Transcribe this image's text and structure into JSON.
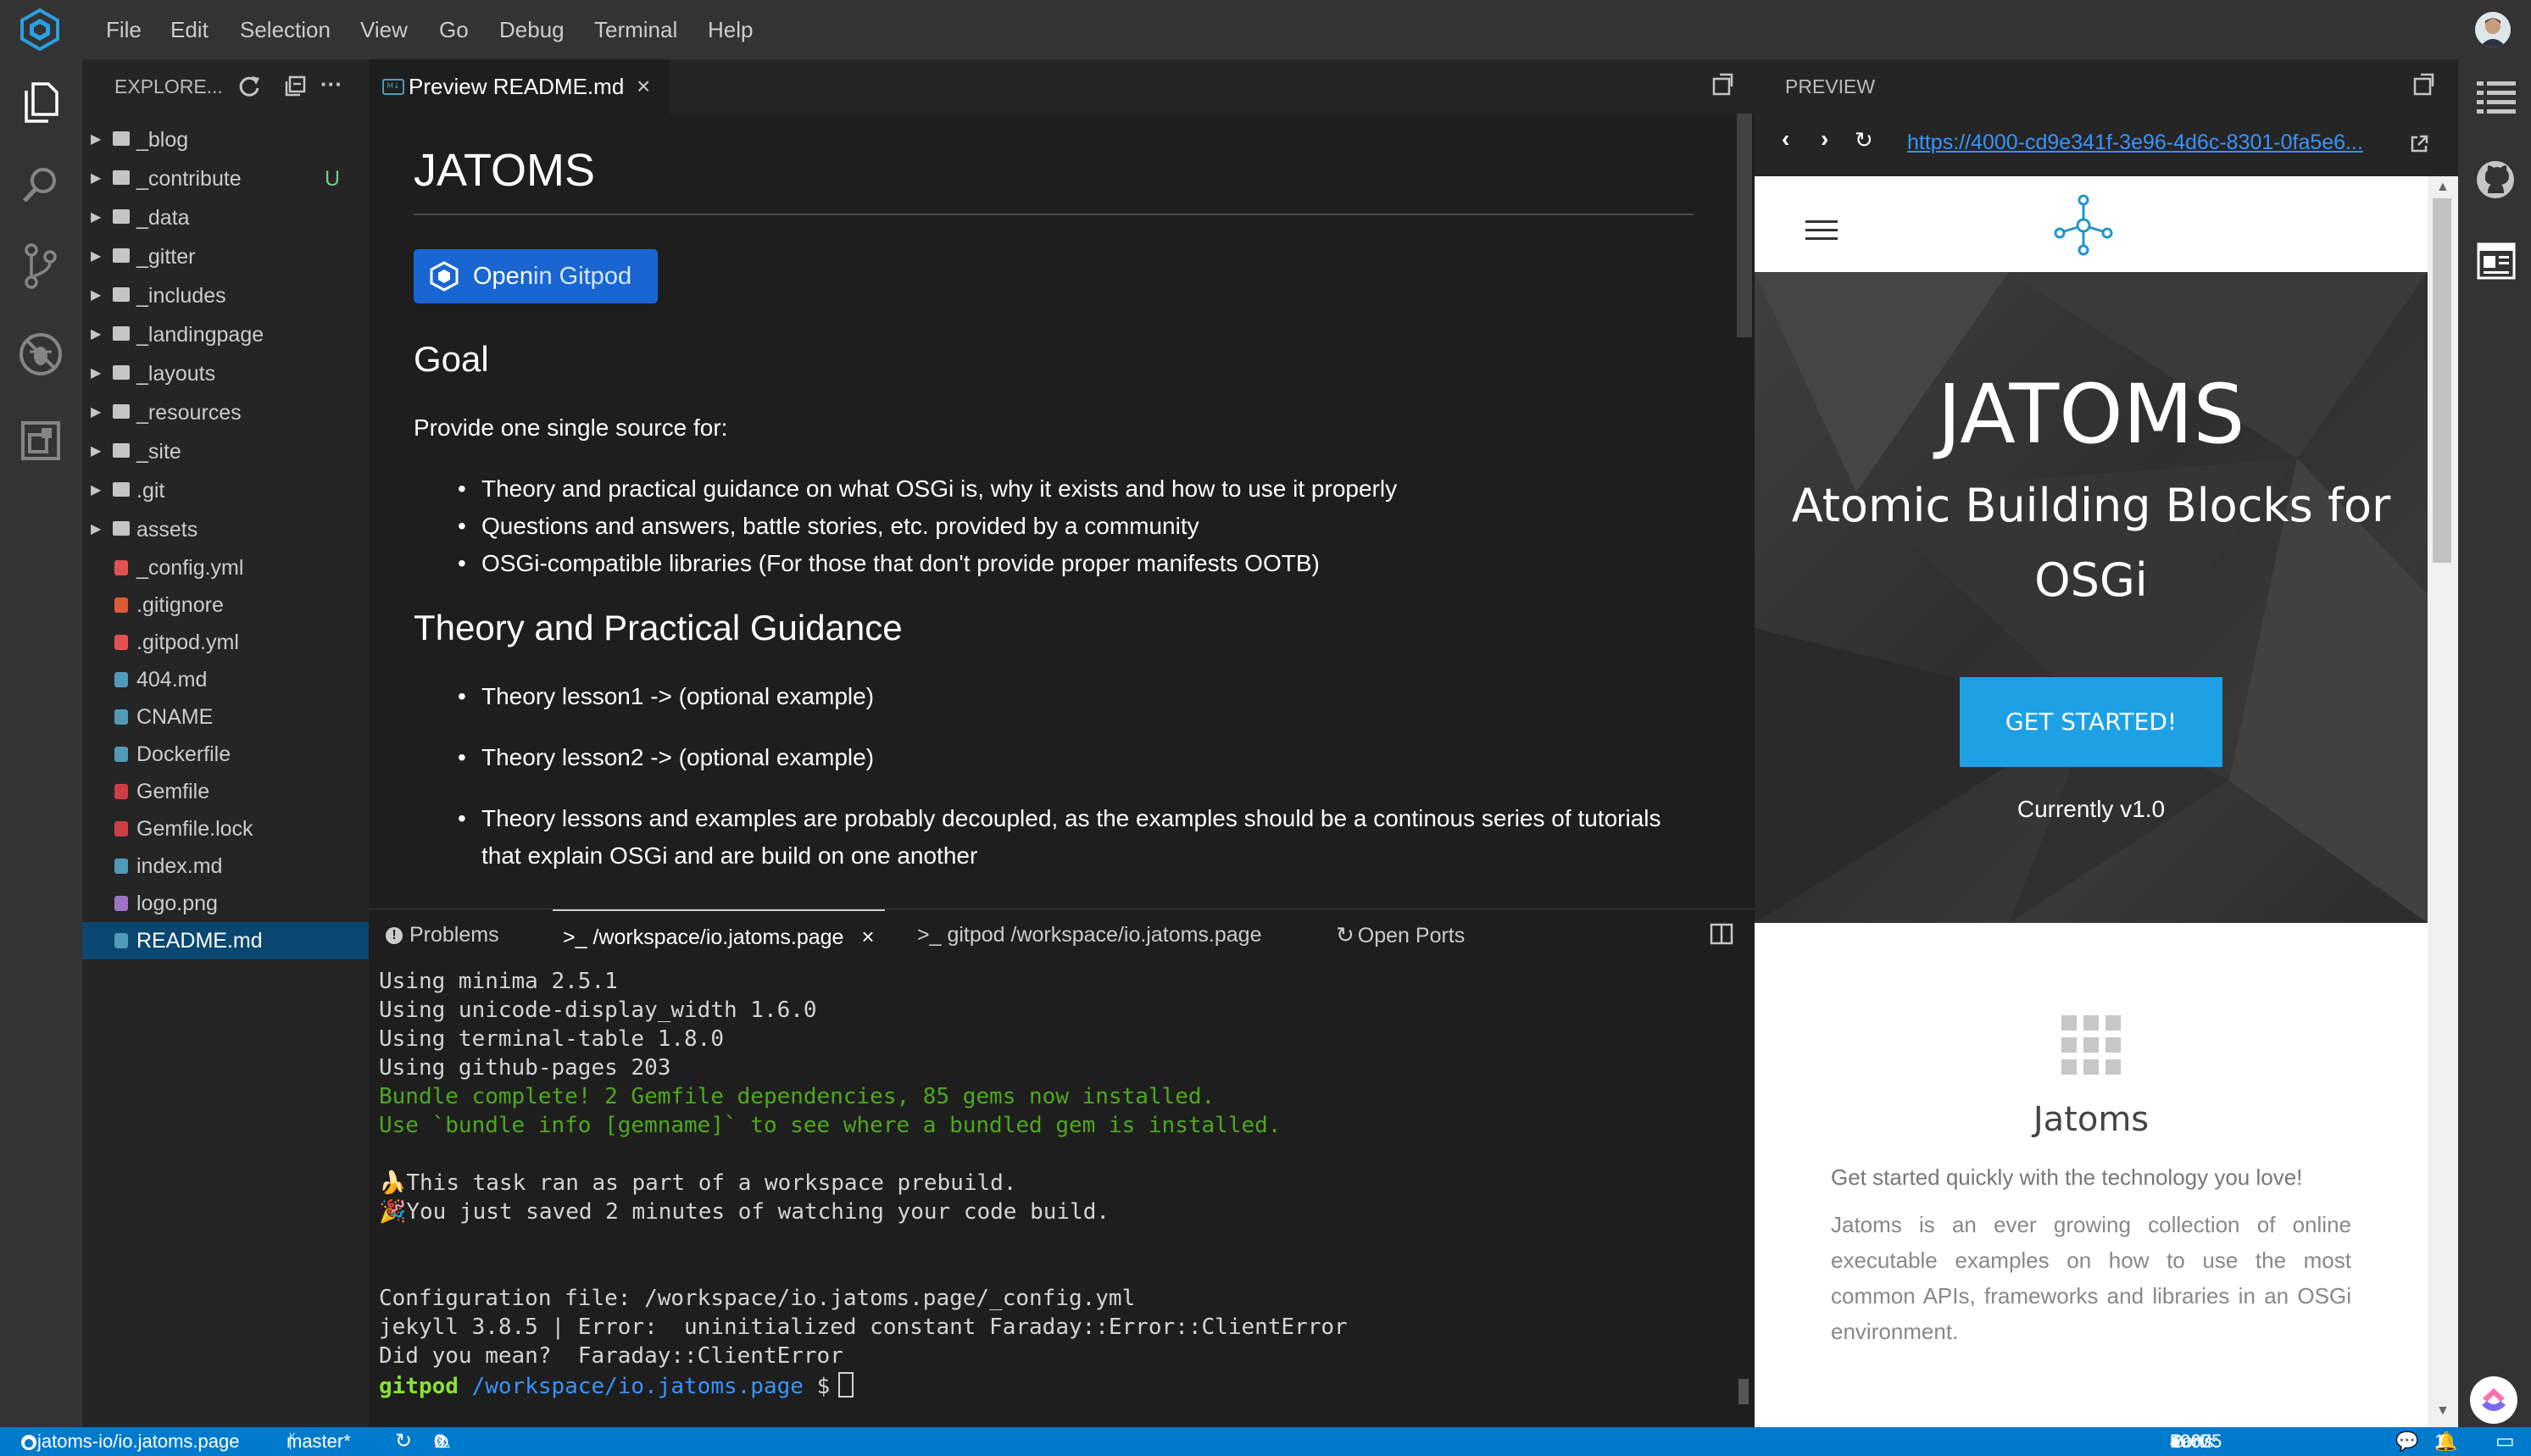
{
  "menubar": {
    "items": [
      "File",
      "Edit",
      "Selection",
      "View",
      "Go",
      "Debug",
      "Terminal",
      "Help"
    ],
    "brand_color": "#2aa0e0"
  },
  "activity_bar": {
    "icons": [
      "files-icon",
      "search-icon",
      "source-control-icon",
      "debug-icon",
      "extensions-icon"
    ]
  },
  "explorer": {
    "title": "EXPLORE...",
    "items": [
      {
        "label": "_blog",
        "type": "folder"
      },
      {
        "label": "_contribute",
        "type": "folder",
        "badge": "U"
      },
      {
        "label": "_data",
        "type": "folder"
      },
      {
        "label": "_gitter",
        "type": "folder"
      },
      {
        "label": "_includes",
        "type": "folder"
      },
      {
        "label": "_landingpage",
        "type": "folder"
      },
      {
        "label": "_layouts",
        "type": "folder"
      },
      {
        "label": "_resources",
        "type": "folder"
      },
      {
        "label": "_site",
        "type": "folder"
      },
      {
        "label": ".git",
        "type": "folder"
      },
      {
        "label": "assets",
        "type": "folder"
      },
      {
        "label": "_config.yml",
        "type": "file",
        "color": "#e05252"
      },
      {
        "label": ".gitignore",
        "type": "file",
        "color": "#e05a36"
      },
      {
        "label": ".gitpod.yml",
        "type": "file",
        "color": "#e05252"
      },
      {
        "label": "404.md",
        "type": "file",
        "color": "#519aba"
      },
      {
        "label": "CNAME",
        "type": "file",
        "color": "#519aba"
      },
      {
        "label": "Dockerfile",
        "type": "file",
        "color": "#519aba"
      },
      {
        "label": "Gemfile",
        "type": "file",
        "color": "#cc3e44"
      },
      {
        "label": "Gemfile.lock",
        "type": "file",
        "color": "#cc3e44"
      },
      {
        "label": "index.md",
        "type": "file",
        "color": "#519aba"
      },
      {
        "label": "logo.png",
        "type": "file",
        "color": "#a074c4"
      },
      {
        "label": "README.md",
        "type": "file",
        "color": "#519aba",
        "selected": true
      }
    ],
    "badge_color": "#73c991"
  },
  "editor": {
    "tab_label": "Preview README.md",
    "h1": "JATOMS",
    "gitpod_button": {
      "open": "Open",
      "in": "in Gitpod"
    },
    "goal_heading": "Goal",
    "goal_text": "Provide one single source for:",
    "goal_items": [
      "Theory and practical guidance on what OSGi is, why it exists and how to use it properly",
      "Questions and answers, battle stories, etc. provided by a community",
      "OSGi-compatible libraries (For those that don't provide proper manifests OOTB)"
    ],
    "theory_heading": "Theory and Practical Guidance",
    "theory_items": [
      "Theory lesson1 -> (optional example)",
      "Theory lesson2 -> (optional example)",
      "Theory lessons and examples are probably decoupled, as the examples should be a continous series of tutorials",
      "that explain OSGi and are build on one another"
    ]
  },
  "panel": {
    "tabs": [
      "Problems",
      ">_ /workspace/io.jatoms.page",
      ">_ gitpod /workspace/io.jatoms.page",
      "Open Ports"
    ],
    "terminal_lines": [
      {
        "text": "Using minima 2.5.1",
        "style": "normal"
      },
      {
        "text": "Using unicode-display_width 1.6.0",
        "style": "normal"
      },
      {
        "text": "Using terminal-table 1.8.0",
        "style": "normal"
      },
      {
        "text": "Using github-pages 203",
        "style": "normal"
      },
      {
        "text": "Bundle complete! 2 Gemfile dependencies, 85 gems now installed.",
        "style": "green"
      },
      {
        "text": "Use `bundle info [gemname]` to see where a bundled gem is installed.",
        "style": "green"
      },
      {
        "text": "",
        "style": "normal"
      },
      {
        "text": "🍌This task ran as part of a workspace prebuild.",
        "style": "normal"
      },
      {
        "text": "🎉You just saved 2 minutes of watching your code build.",
        "style": "normal"
      },
      {
        "text": "",
        "style": "normal"
      },
      {
        "text": "",
        "style": "normal"
      },
      {
        "text": "Configuration file: /workspace/io.jatoms.page/_config.yml",
        "style": "normal"
      },
      {
        "text": "jekyll 3.8.5 | Error:  uninitialized constant Faraday::Error::ClientError",
        "style": "normal"
      },
      {
        "text": "Did you mean?  Faraday::ClientError",
        "style": "normal"
      }
    ],
    "prompt_user": "gitpod",
    "prompt_path": "/workspace/io.jatoms.page",
    "prompt_symbol": "$"
  },
  "preview": {
    "title": "PREVIEW",
    "url": "https://4000-cd9e341f-3e96-4d6c-8301-0fa5e6...",
    "hero_title": "JATOMS",
    "hero_subtitle_1": "Atomic Building Blocks for",
    "hero_subtitle_2": "OSGi",
    "cta": "GET STARTED!",
    "version": "Currently v1.0",
    "section_title": "Jatoms",
    "section_lead": "Get started quickly with the technology you love!",
    "section_body": [
      "Jatoms is an ever growing collection of online",
      "executable examples on how to use the most",
      "common APIs, frameworks and libraries in an OSGi",
      "environment."
    ],
    "cta_color": "#1ea0e4",
    "accent_color": "#2196c9"
  },
  "status_bar": {
    "repo": "jatoms-io/io.jatoms.page",
    "branch": "master*",
    "errors": "0",
    "warnings": "0",
    "ports_label": "Ports:",
    "port_open": "4000",
    "port_blocked": "59675",
    "notifications": "1",
    "background": "#007acc"
  }
}
